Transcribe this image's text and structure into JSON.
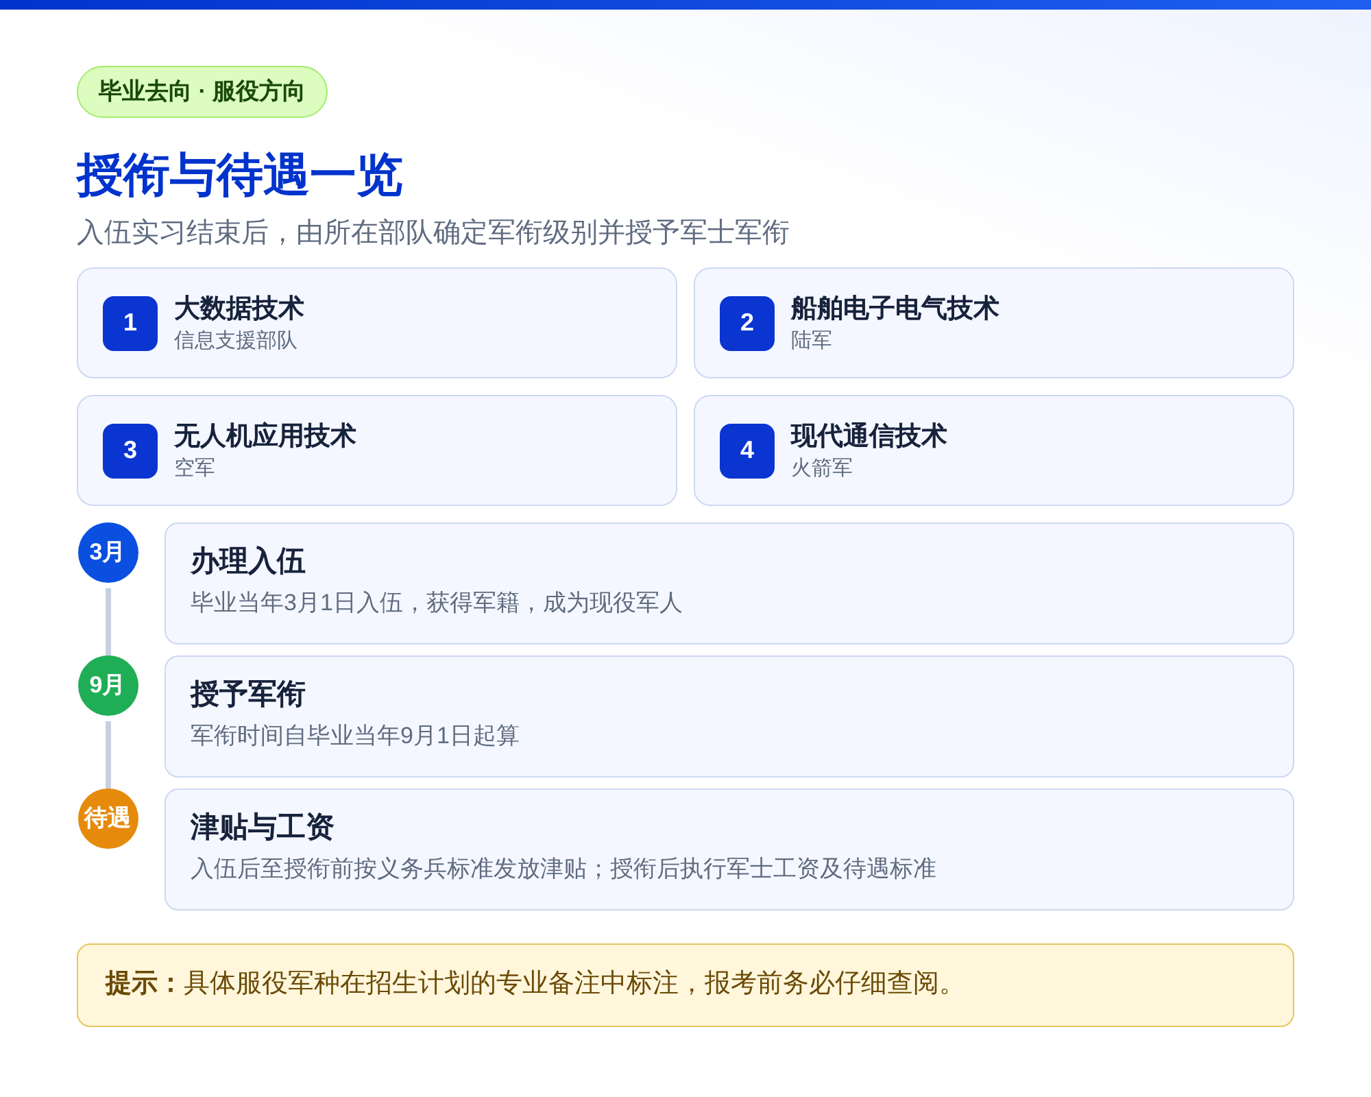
{
  "badge": "毕业去向 · 服役方向",
  "title": "授衔与待遇一览",
  "subtitle": "入伍实习结束后，由所在部队确定军衔级别并授予军士军衔",
  "majors": [
    {
      "number": "1",
      "name": "大数据技术",
      "branch": "信息支援部队"
    },
    {
      "number": "2",
      "name": "船舶电子电气技术",
      "branch": "陆军"
    },
    {
      "number": "3",
      "name": "无人机应用技术",
      "branch": "空军"
    },
    {
      "number": "4",
      "name": "现代通信技术",
      "branch": "火箭军"
    }
  ],
  "timeline": [
    {
      "marker": "3月",
      "color": "#0a4fe0",
      "title": "办理入伍",
      "description": "毕业当年3月1日入伍，获得军籍，成为现役军人"
    },
    {
      "marker": "9月",
      "color": "#1fae55",
      "title": "授予军衔",
      "description": "军衔时间自毕业当年9月1日起算"
    },
    {
      "marker": "待遇",
      "color": "#e68a0c",
      "title": "津贴与工资",
      "description": "入伍后至授衔前按义务兵标准发放津贴；授衔后执行军士工资及待遇标准"
    }
  ],
  "note": "**提示：**具体服役军种在招生计划的专业备注中标注，报考前务必仔细查阅。"
}
